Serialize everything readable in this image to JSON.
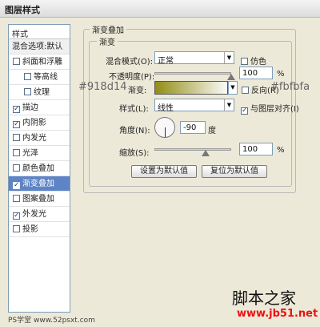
{
  "window": {
    "title": "图层样式"
  },
  "styles_panel": {
    "header": "样式",
    "blend_options": "混合选项:默认",
    "items": [
      {
        "label": "斜面和浮雕",
        "checked": false,
        "sub": false
      },
      {
        "label": "等高线",
        "checked": false,
        "sub": true
      },
      {
        "label": "纹理",
        "checked": false,
        "sub": true
      },
      {
        "label": "描边",
        "checked": true,
        "sub": false
      },
      {
        "label": "内阴影",
        "checked": true,
        "sub": false
      },
      {
        "label": "内发光",
        "checked": false,
        "sub": false
      },
      {
        "label": "光泽",
        "checked": false,
        "sub": false
      },
      {
        "label": "颜色叠加",
        "checked": false,
        "sub": false
      },
      {
        "label": "渐变叠加",
        "checked": true,
        "sub": false,
        "selected": true
      },
      {
        "label": "图案叠加",
        "checked": false,
        "sub": false
      },
      {
        "label": "外发光",
        "checked": true,
        "sub": false
      },
      {
        "label": "投影",
        "checked": false,
        "sub": false
      }
    ]
  },
  "gradient_overlay": {
    "group_title": "渐变叠加",
    "sub_title": "渐变",
    "blend_mode_label": "混合模式(O):",
    "blend_mode_value": "正常",
    "dither_label": "仿色",
    "opacity_label": "不透明度(P):",
    "opacity_value": "100",
    "opacity_unit": "%",
    "gradient_label": "渐变:",
    "reverse_label": "反向(R)",
    "style_label": "样式(L):",
    "style_value": "线性",
    "align_label": "与图层对齐(I)",
    "angle_label": "角度(N):",
    "angle_value": "-90",
    "angle_unit": "度",
    "scale_label": "缩放(S):",
    "scale_value": "100",
    "scale_unit": "%",
    "set_default_button": "设置为默认值",
    "reset_default_button": "复位为默认值"
  },
  "annotations": {
    "color_left": "#918d14",
    "color_right": "#fbfbfa"
  },
  "watermark": {
    "site_name": "脚本之家",
    "url": "www.jb51.net",
    "logo": "PS学堂 www.52psxt.com"
  }
}
